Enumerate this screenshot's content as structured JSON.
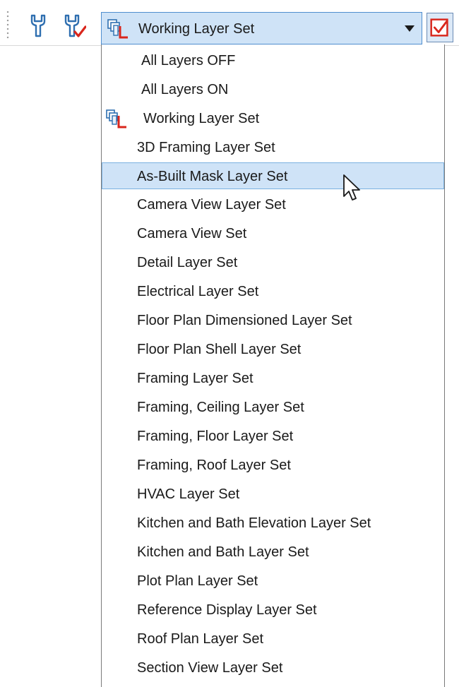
{
  "toolbar": {
    "icons": [
      "wrench-icon",
      "wrench-check-icon"
    ],
    "layer_set_combo": {
      "selected": "Working Layer Set",
      "icon": "layer-set-icon",
      "arrow_icon": "dropdown-arrow-icon"
    },
    "checkbox_icon": "checkbox-checked-icon"
  },
  "dropdown": {
    "items": [
      {
        "label": "All Layers OFF"
      },
      {
        "label": "All Layers ON"
      },
      {
        "label": "Working Layer Set",
        "icon": "layer-set-icon"
      },
      {
        "label": "3D Framing Layer Set"
      },
      {
        "label": "As-Built Mask Layer Set",
        "highlighted": true
      },
      {
        "label": "Camera View Layer Set"
      },
      {
        "label": "Camera View Set"
      },
      {
        "label": "Detail Layer Set"
      },
      {
        "label": "Electrical Layer Set"
      },
      {
        "label": "Floor Plan Dimensioned Layer Set"
      },
      {
        "label": "Floor Plan Shell Layer Set"
      },
      {
        "label": "Framing Layer Set"
      },
      {
        "label": "Framing, Ceiling Layer Set"
      },
      {
        "label": "Framing, Floor Layer Set"
      },
      {
        "label": "Framing, Roof Layer Set"
      },
      {
        "label": "HVAC Layer Set"
      },
      {
        "label": "Kitchen and Bath Elevation Layer Set"
      },
      {
        "label": "Kitchen and Bath Layer Set"
      },
      {
        "label": "Plot Plan Layer Set"
      },
      {
        "label": "Reference Display Layer Set"
      },
      {
        "label": "Roof Plan Layer Set"
      },
      {
        "label": "Section View Layer Set"
      }
    ]
  },
  "colors": {
    "highlight_fill": "#cfe3f7",
    "highlight_border": "#7ab0e0",
    "icon_blue": "#2f6fb0",
    "icon_red": "#d9261c"
  }
}
